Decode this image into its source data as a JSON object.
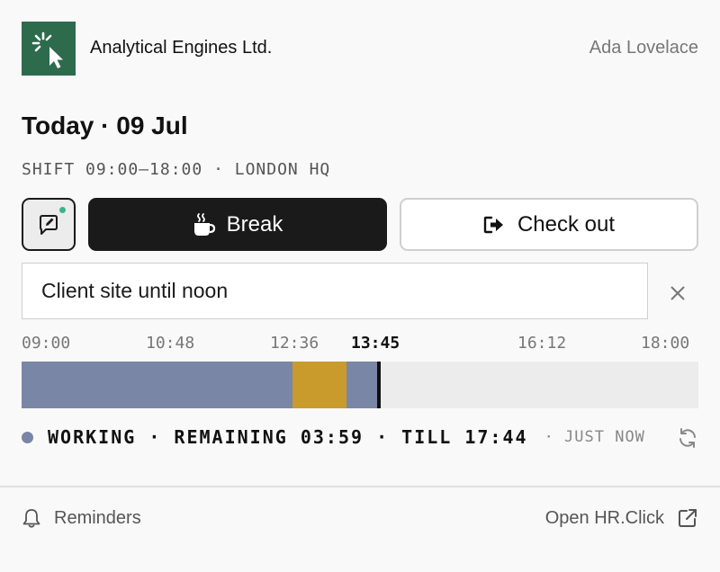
{
  "header": {
    "company": "Analytical Engines Ltd.",
    "user": "Ada Lovelace"
  },
  "day": {
    "title": "Today · 09 Jul",
    "shift": "SHIFT 09:00–18:00 · LONDON HQ"
  },
  "actions": {
    "note_icon": "note-edit-icon",
    "break_label": "Break",
    "break_icon": "coffee-cup-icon",
    "checkout_label": "Check out",
    "checkout_icon": "sign-out-icon"
  },
  "note": {
    "value": "Client site until noon",
    "clear_icon": "close-icon"
  },
  "timeline": {
    "ticks": [
      "09:00",
      "10:48",
      "12:36",
      "13:45",
      "16:12",
      "18:00"
    ],
    "now_label": "13:45",
    "start": "09:00",
    "end": "18:00",
    "segments": [
      {
        "type": "working",
        "from": "09:00",
        "to": "12:36"
      },
      {
        "type": "break",
        "from": "12:36",
        "to": "13:19"
      },
      {
        "type": "working",
        "from": "13:19",
        "to": "13:45"
      }
    ],
    "colors": {
      "working": "#7a86a6",
      "break": "#c99a2c",
      "remaining": "#ececec",
      "now_marker": "#111111"
    }
  },
  "status": {
    "text": "WORKING · REMAINING 03:59 · TILL 17:44",
    "updated": "· JUST NOW",
    "dot_color": "#7a86a6",
    "refresh_icon": "refresh-icon"
  },
  "footer": {
    "reminders_label": "Reminders",
    "reminders_icon": "bell-icon",
    "open_label": "Open HR.Click",
    "open_icon": "external-link-icon"
  },
  "colors": {
    "brand": "#2d6b4c",
    "accent_dot": "#3cb48a",
    "primary_button": "#1a1a1a"
  }
}
